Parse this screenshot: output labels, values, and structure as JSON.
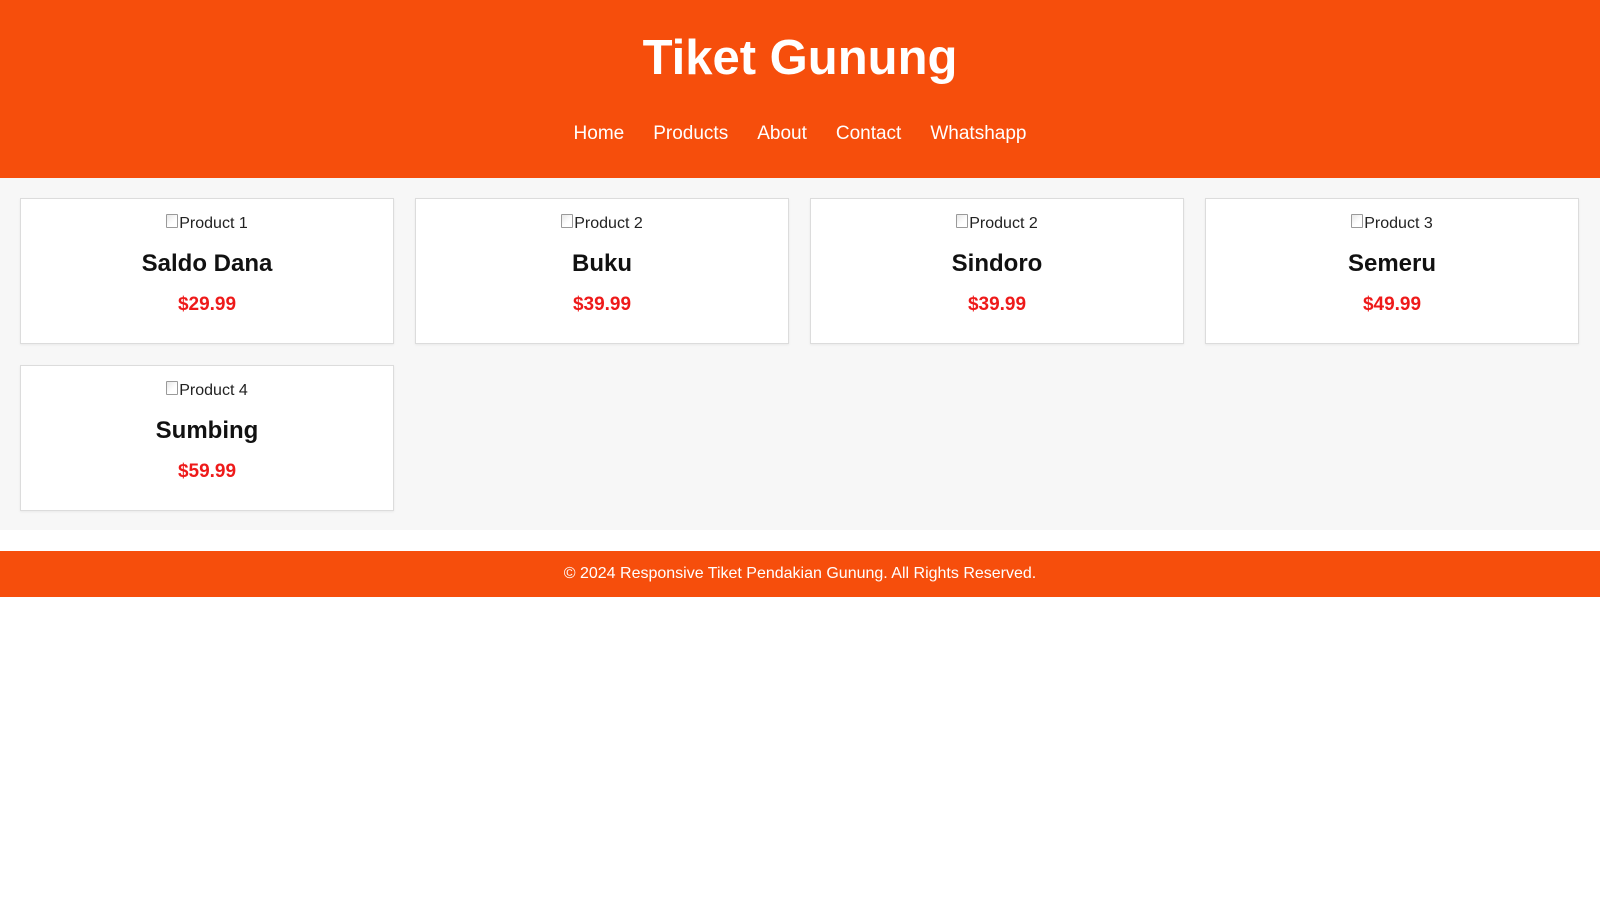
{
  "header": {
    "title": "Tiket Gunung",
    "nav": [
      "Home",
      "Products",
      "About",
      "Contact",
      "Whatshapp"
    ]
  },
  "products": [
    {
      "image_alt": "Product 1",
      "name": "Saldo Dana",
      "price": "$29.99"
    },
    {
      "image_alt": "Product 2",
      "name": "Buku",
      "price": "$39.99"
    },
    {
      "image_alt": "Product 2",
      "name": "Sindoro",
      "price": "$39.99"
    },
    {
      "image_alt": "Product 3",
      "name": "Semeru",
      "price": "$49.99"
    },
    {
      "image_alt": "Product 4",
      "name": "Sumbing",
      "price": "$59.99"
    }
  ],
  "footer": {
    "text": "© 2024 Responsive Tiket Pendakian Gunung. All Rights Reserved."
  },
  "colors": {
    "brand": "#f64e0c",
    "price": "#ee1a1a",
    "main_bg": "#f7f7f7"
  }
}
